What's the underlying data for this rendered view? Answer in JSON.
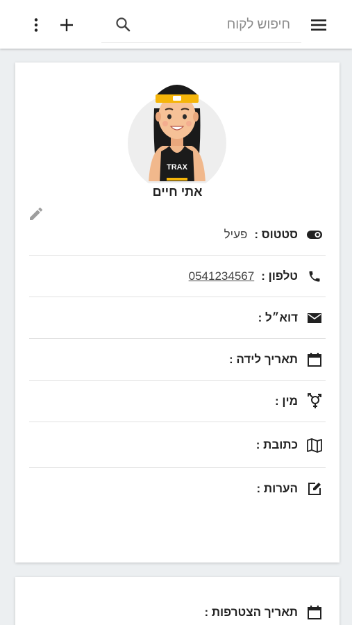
{
  "header": {
    "search": {
      "placeholder": "חיפוש לקוח",
      "value": ""
    }
  },
  "client": {
    "name": "אתי חיים",
    "avatar_badge_text": "TRAX"
  },
  "details": [
    {
      "key": "status",
      "icon": "toggle-icon",
      "label": "סטטוס :",
      "value": "פעיל"
    },
    {
      "key": "phone",
      "icon": "phone-icon",
      "label": "טלפון :",
      "value": "0541234567"
    },
    {
      "key": "email",
      "icon": "envelope-icon",
      "label": "דוא״ל :",
      "value": ""
    },
    {
      "key": "birthdate",
      "icon": "calendar-icon",
      "label": "תאריך לידה :",
      "value": ""
    },
    {
      "key": "gender",
      "icon": "gender-icon",
      "label": "מין :",
      "value": ""
    },
    {
      "key": "address",
      "icon": "map-icon",
      "label": "כתובת :",
      "value": ""
    },
    {
      "key": "notes",
      "icon": "edit-note-icon",
      "label": "הערות :",
      "value": ""
    }
  ],
  "membership": {
    "join_date_label": "תאריך הצטרפות :",
    "join_date_value": ""
  },
  "colors": {
    "header_bg": "#ffffff",
    "page_bg": "#eceff1",
    "avatar_circle": "#eeeeee",
    "headband": "#f5b50a",
    "icon": "#212121"
  }
}
